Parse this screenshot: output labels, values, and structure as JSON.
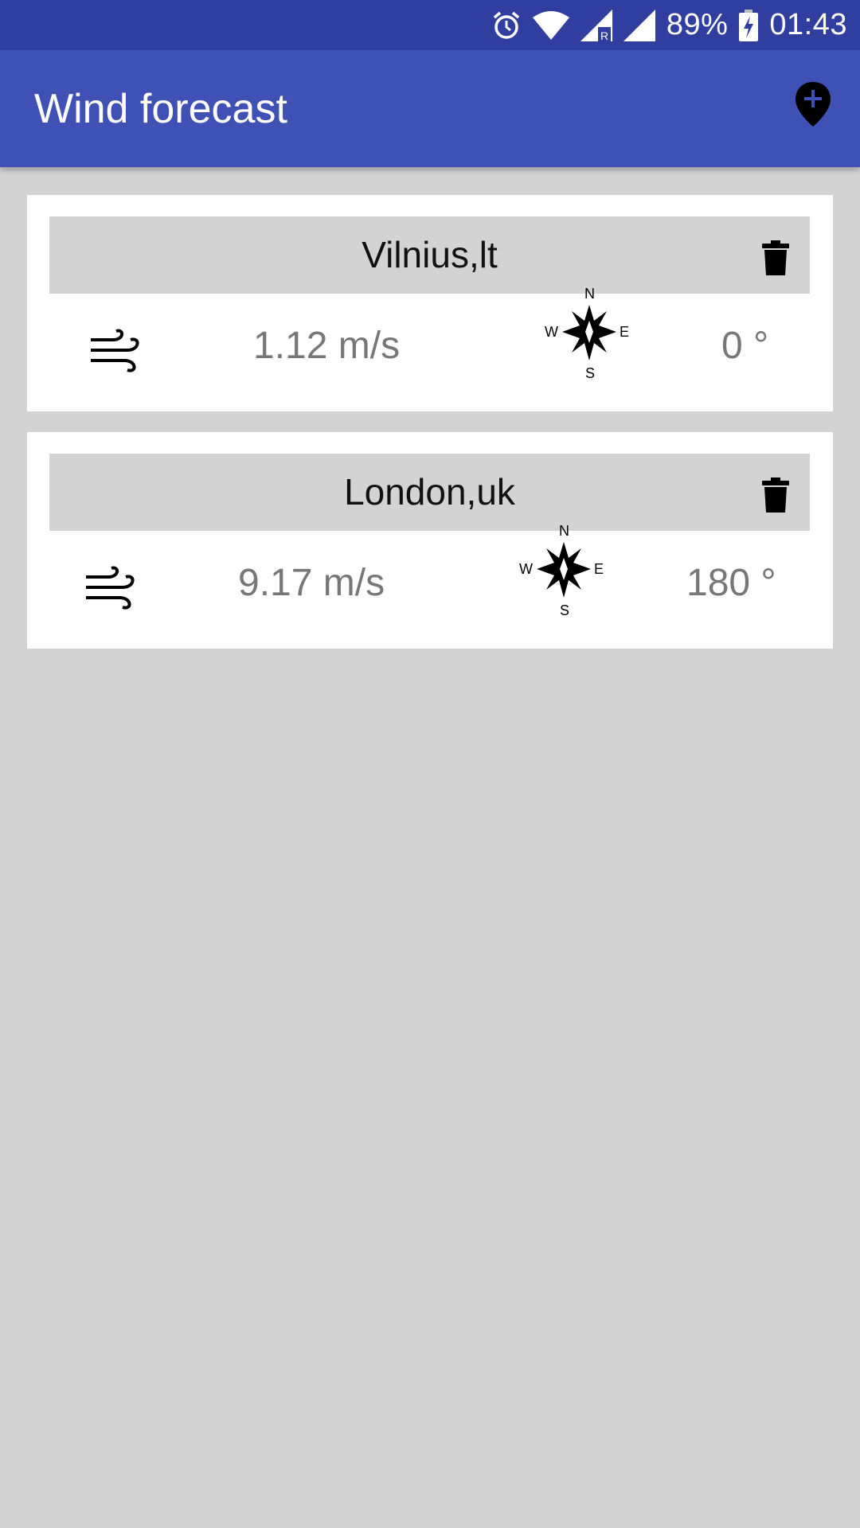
{
  "status_bar": {
    "icons": [
      "alarm-icon",
      "wifi-icon",
      "cell-signal-roaming-icon",
      "cell-signal-icon",
      "battery-charging-icon"
    ],
    "battery": "89%",
    "time": "01:43"
  },
  "app_bar": {
    "title": "Wind forecast",
    "action_icon": "add-location-icon"
  },
  "cities": [
    {
      "name": "Vilnius,lt",
      "speed": "1.12 m/s",
      "direction": "0 °"
    },
    {
      "name": "London,uk",
      "speed": "9.17 m/s",
      "direction": "180 °"
    }
  ],
  "compass_labels": {
    "n": "N",
    "e": "E",
    "s": "S",
    "w": "W"
  },
  "colors": {
    "status_bar": "#303f9f",
    "app_bar": "#3f51b5",
    "background": "#d3d3d3",
    "card": "#ffffff",
    "card_header": "#d3d3d3",
    "value_text": "#777777"
  }
}
